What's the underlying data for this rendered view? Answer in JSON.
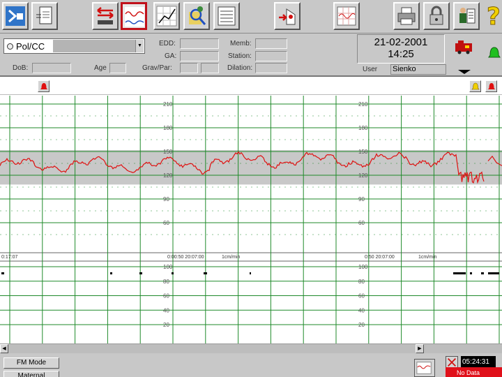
{
  "toolbar": {
    "buttons": [
      {
        "name": "bed-overview-button",
        "icon": "bed-overview-icon",
        "active": false
      },
      {
        "name": "patient-record-button",
        "icon": "patient-record-icon",
        "active": false
      },
      {
        "name": "transfer-bed-button",
        "icon": "transfer-bed-icon",
        "active": false
      },
      {
        "name": "ctg-trace-button",
        "icon": "ctg-trace-icon",
        "active": true
      },
      {
        "name": "partogram-button",
        "icon": "partogram-icon",
        "active": false
      },
      {
        "name": "search-patient-button",
        "icon": "search-patient-icon",
        "active": false
      },
      {
        "name": "notes-button",
        "icon": "notes-icon",
        "active": false
      },
      {
        "name": "admit-discharge-button",
        "icon": "admit-discharge-icon",
        "active": false
      },
      {
        "name": "trace-grid-button",
        "icon": "trace-grid-icon",
        "active": false
      },
      {
        "name": "print-button",
        "icon": "printer-icon",
        "active": false
      },
      {
        "name": "lock-button",
        "icon": "lock-icon",
        "active": false
      },
      {
        "name": "staff-button",
        "icon": "staff-icon",
        "active": false
      },
      {
        "name": "help-button",
        "icon": "question-mark-icon",
        "active": false
      }
    ]
  },
  "patient": {
    "name": "Pol/CC",
    "dob_label": "DoB:",
    "age_label": "Age",
    "edd_label": "EDD:",
    "ga_label": "GA:",
    "gravpar_label": "Grav/Par:",
    "member_label": "Memb:",
    "station_label": "Station:",
    "dilation_label": "Dilation:"
  },
  "clock": {
    "date": "21-02-2001",
    "time": "14:25"
  },
  "user": {
    "label": "User",
    "value": "Sienko"
  },
  "trace": {
    "fhr_ticks": [
      "210",
      "180",
      "150",
      "120",
      "90",
      "60"
    ],
    "toco_ticks": [
      "100",
      "80",
      "60",
      "40",
      "20"
    ],
    "fhr_band": [
      110,
      150
    ],
    "left_time": "0:17:07",
    "mid_time": "0:00:50 20:07:00",
    "right_time": "0:50 20:07:00",
    "mid_speed": "1cm/min",
    "right_speed": "1cm/min"
  },
  "bottom": {
    "fm_mode": "FM Mode",
    "maternal": "Maternal",
    "time": "05:24:31",
    "no_data": "No Data"
  },
  "colors": {
    "trace": "#e01010",
    "grid": "#1f8a2a",
    "band": "#c8c8c8",
    "alarm": "#e01010"
  }
}
